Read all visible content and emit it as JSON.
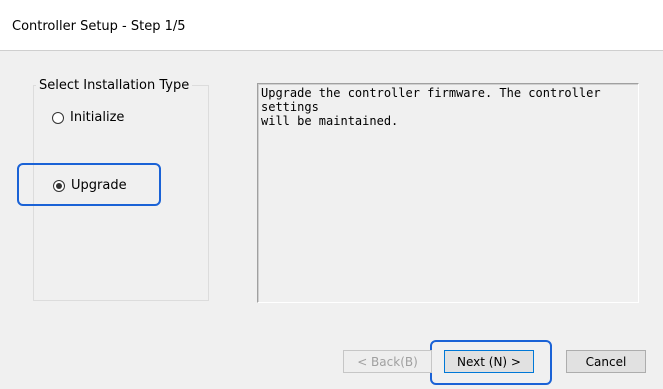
{
  "window": {
    "title": "Controller Setup - Step 1/5"
  },
  "group": {
    "legend": "Select Installation Type",
    "options": [
      {
        "label": "Initialize",
        "selected": false
      },
      {
        "label": "Upgrade",
        "selected": true
      }
    ]
  },
  "description": "Upgrade the controller firmware. The controller settings\nwill be maintained.",
  "buttons": {
    "back": "< Back(B)",
    "next": "Next (N) >",
    "cancel": "Cancel"
  },
  "colors": {
    "highlight": "#1a62d6",
    "dialog_bg": "#f0f0f0"
  }
}
